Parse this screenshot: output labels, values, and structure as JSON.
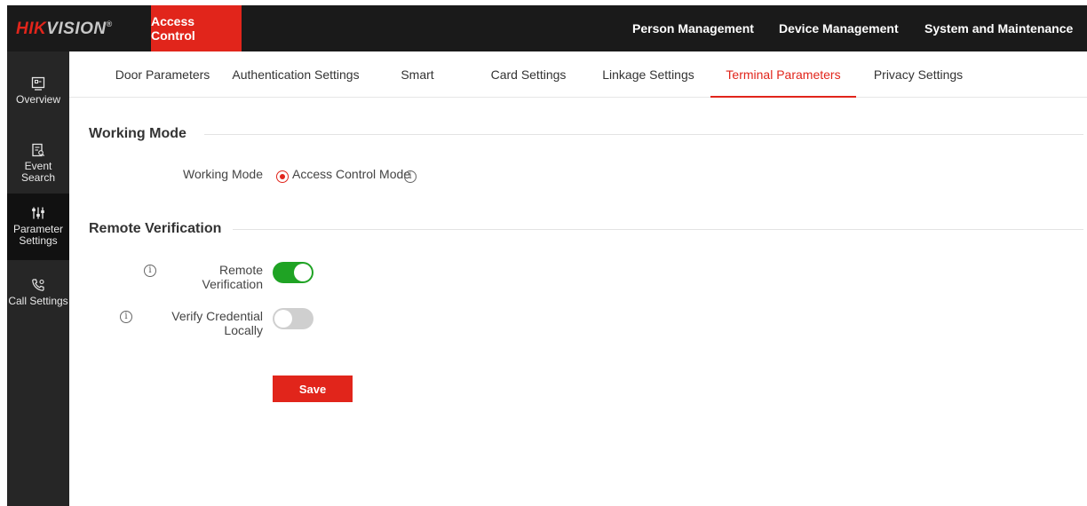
{
  "header": {
    "logo_brand": "HIK",
    "logo_rest": "VISION",
    "logo_mark": "®",
    "module_label": "Access Control",
    "nav": [
      "Person Management",
      "Device Management",
      "System and Maintenance"
    ]
  },
  "sidebar": {
    "items": [
      {
        "label": "Overview",
        "icon": "overview-icon"
      },
      {
        "label": "Event Search",
        "icon": "event-search-icon"
      },
      {
        "label": "Parameter Settings",
        "icon": "parameter-settings-icon",
        "active": true
      },
      {
        "label": "Call Settings",
        "icon": "call-settings-icon"
      }
    ]
  },
  "subnav": {
    "tabs": [
      {
        "label": "Door Parameters"
      },
      {
        "label": "Authentication Settings"
      },
      {
        "label": "Smart"
      },
      {
        "label": "Card Settings"
      },
      {
        "label": "Linkage Settings"
      },
      {
        "label": "Terminal Parameters",
        "active": true
      },
      {
        "label": "Privacy Settings"
      }
    ]
  },
  "working_mode": {
    "section_title": "Working Mode",
    "field_label": "Working Mode",
    "selected_option": "Access Control Mode"
  },
  "remote_verification": {
    "section_title": "Remote Verification",
    "remote_verification_label": "Remote Verification",
    "remote_verification_on": true,
    "verify_locally_label": "Verify Credential Locally",
    "verify_locally_on": false
  },
  "actions": {
    "save_label": "Save"
  },
  "colors": {
    "accent": "#e1251b",
    "toggle_on": "#1fa324",
    "toggle_off": "#cfcfcf",
    "header_bg": "#1a1a1a",
    "sidebar_bg": "#262626"
  }
}
